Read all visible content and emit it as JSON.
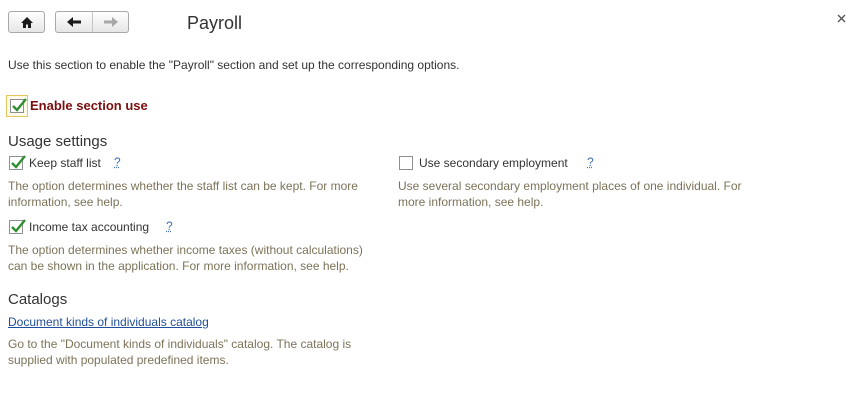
{
  "header": {
    "title": "Payroll",
    "home_icon": "home-icon",
    "back_icon": "arrow-left-icon",
    "forward_icon": "arrow-right-icon",
    "close_glyph": "×"
  },
  "description": "Use this section to enable the \"Payroll\" section and set up the corresponding options.",
  "enable_section": {
    "label": "Enable section use",
    "checked": true
  },
  "usage_settings": {
    "title": "Usage settings",
    "keep_staff_list": {
      "label": "Keep staff list",
      "checked": true,
      "help": "?",
      "hint_line1": "The option determines whether the staff list can be kept. For more",
      "hint_line2": "information, see help."
    },
    "secondary_employment": {
      "label": "Use secondary employment",
      "checked": false,
      "help": "?",
      "hint_line1": "Use several secondary employment places of one individual. For",
      "hint_line2": "more information, see help."
    },
    "income_tax": {
      "label": "Income tax accounting",
      "checked": true,
      "help": "?",
      "hint_line1": "The option determines whether income taxes (without calculations)",
      "hint_line2": "can be shown in the application. For more information, see help."
    }
  },
  "catalogs": {
    "title": "Catalogs",
    "doc_kinds_link": "Document kinds of individuals catalog",
    "hint_line1": "Go to the \"Document kinds of individuals\" catalog. The catalog is",
    "hint_line2": "supplied with populated predefined items."
  },
  "colors": {
    "accent_red": "#7a0e0e",
    "check_green": "#2f8f2f",
    "link_blue": "#1f4f9a",
    "hint_text": "#7c7358"
  }
}
